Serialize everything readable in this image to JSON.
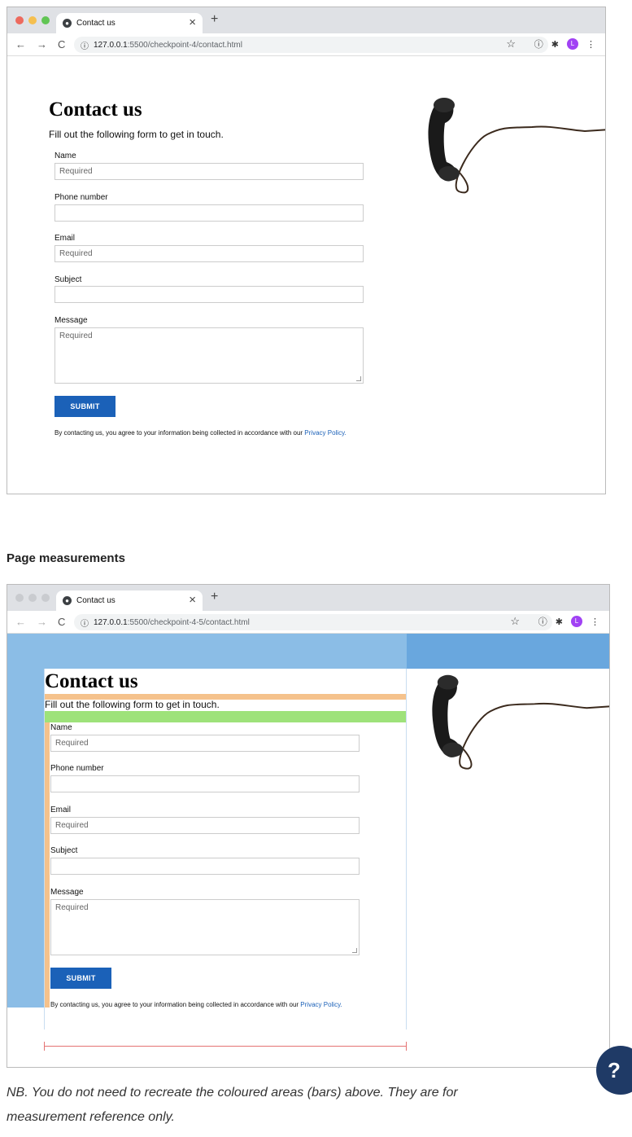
{
  "browser": {
    "tab_title": "Contact us",
    "url_host": "127.0.0.1",
    "url_path_1": ":5500/checkpoint-4/contact.html",
    "url_path_2": ":5500/checkpoint-4-5/contact.html",
    "avatar_letter": "L"
  },
  "form": {
    "title": "Contact us",
    "intro": "Fill out the following form to get in touch.",
    "name_label": "Name",
    "name_placeholder": "Required",
    "phone_label": "Phone number",
    "email_label": "Email",
    "email_placeholder": "Required",
    "subject_label": "Subject",
    "message_label": "Message",
    "message_placeholder": "Required",
    "submit_label": "SUBMIT",
    "disclaimer": "By contacting us, you agree to your information being collected in accordance with our",
    "privacy_link": "Privacy Policy."
  },
  "section_title": "Page measurements",
  "note_line1": "NB. You do not need to recreate the coloured areas (bars) above. They are for",
  "note_line2": "measurement reference only.",
  "help_icon": "?",
  "colors": {
    "accent": "#1b61b8",
    "bar_blue": "#8bbde6",
    "bar_blue_dark": "#69a7de",
    "bar_orange": "#f5c28c",
    "bar_green": "#9ee27a"
  }
}
